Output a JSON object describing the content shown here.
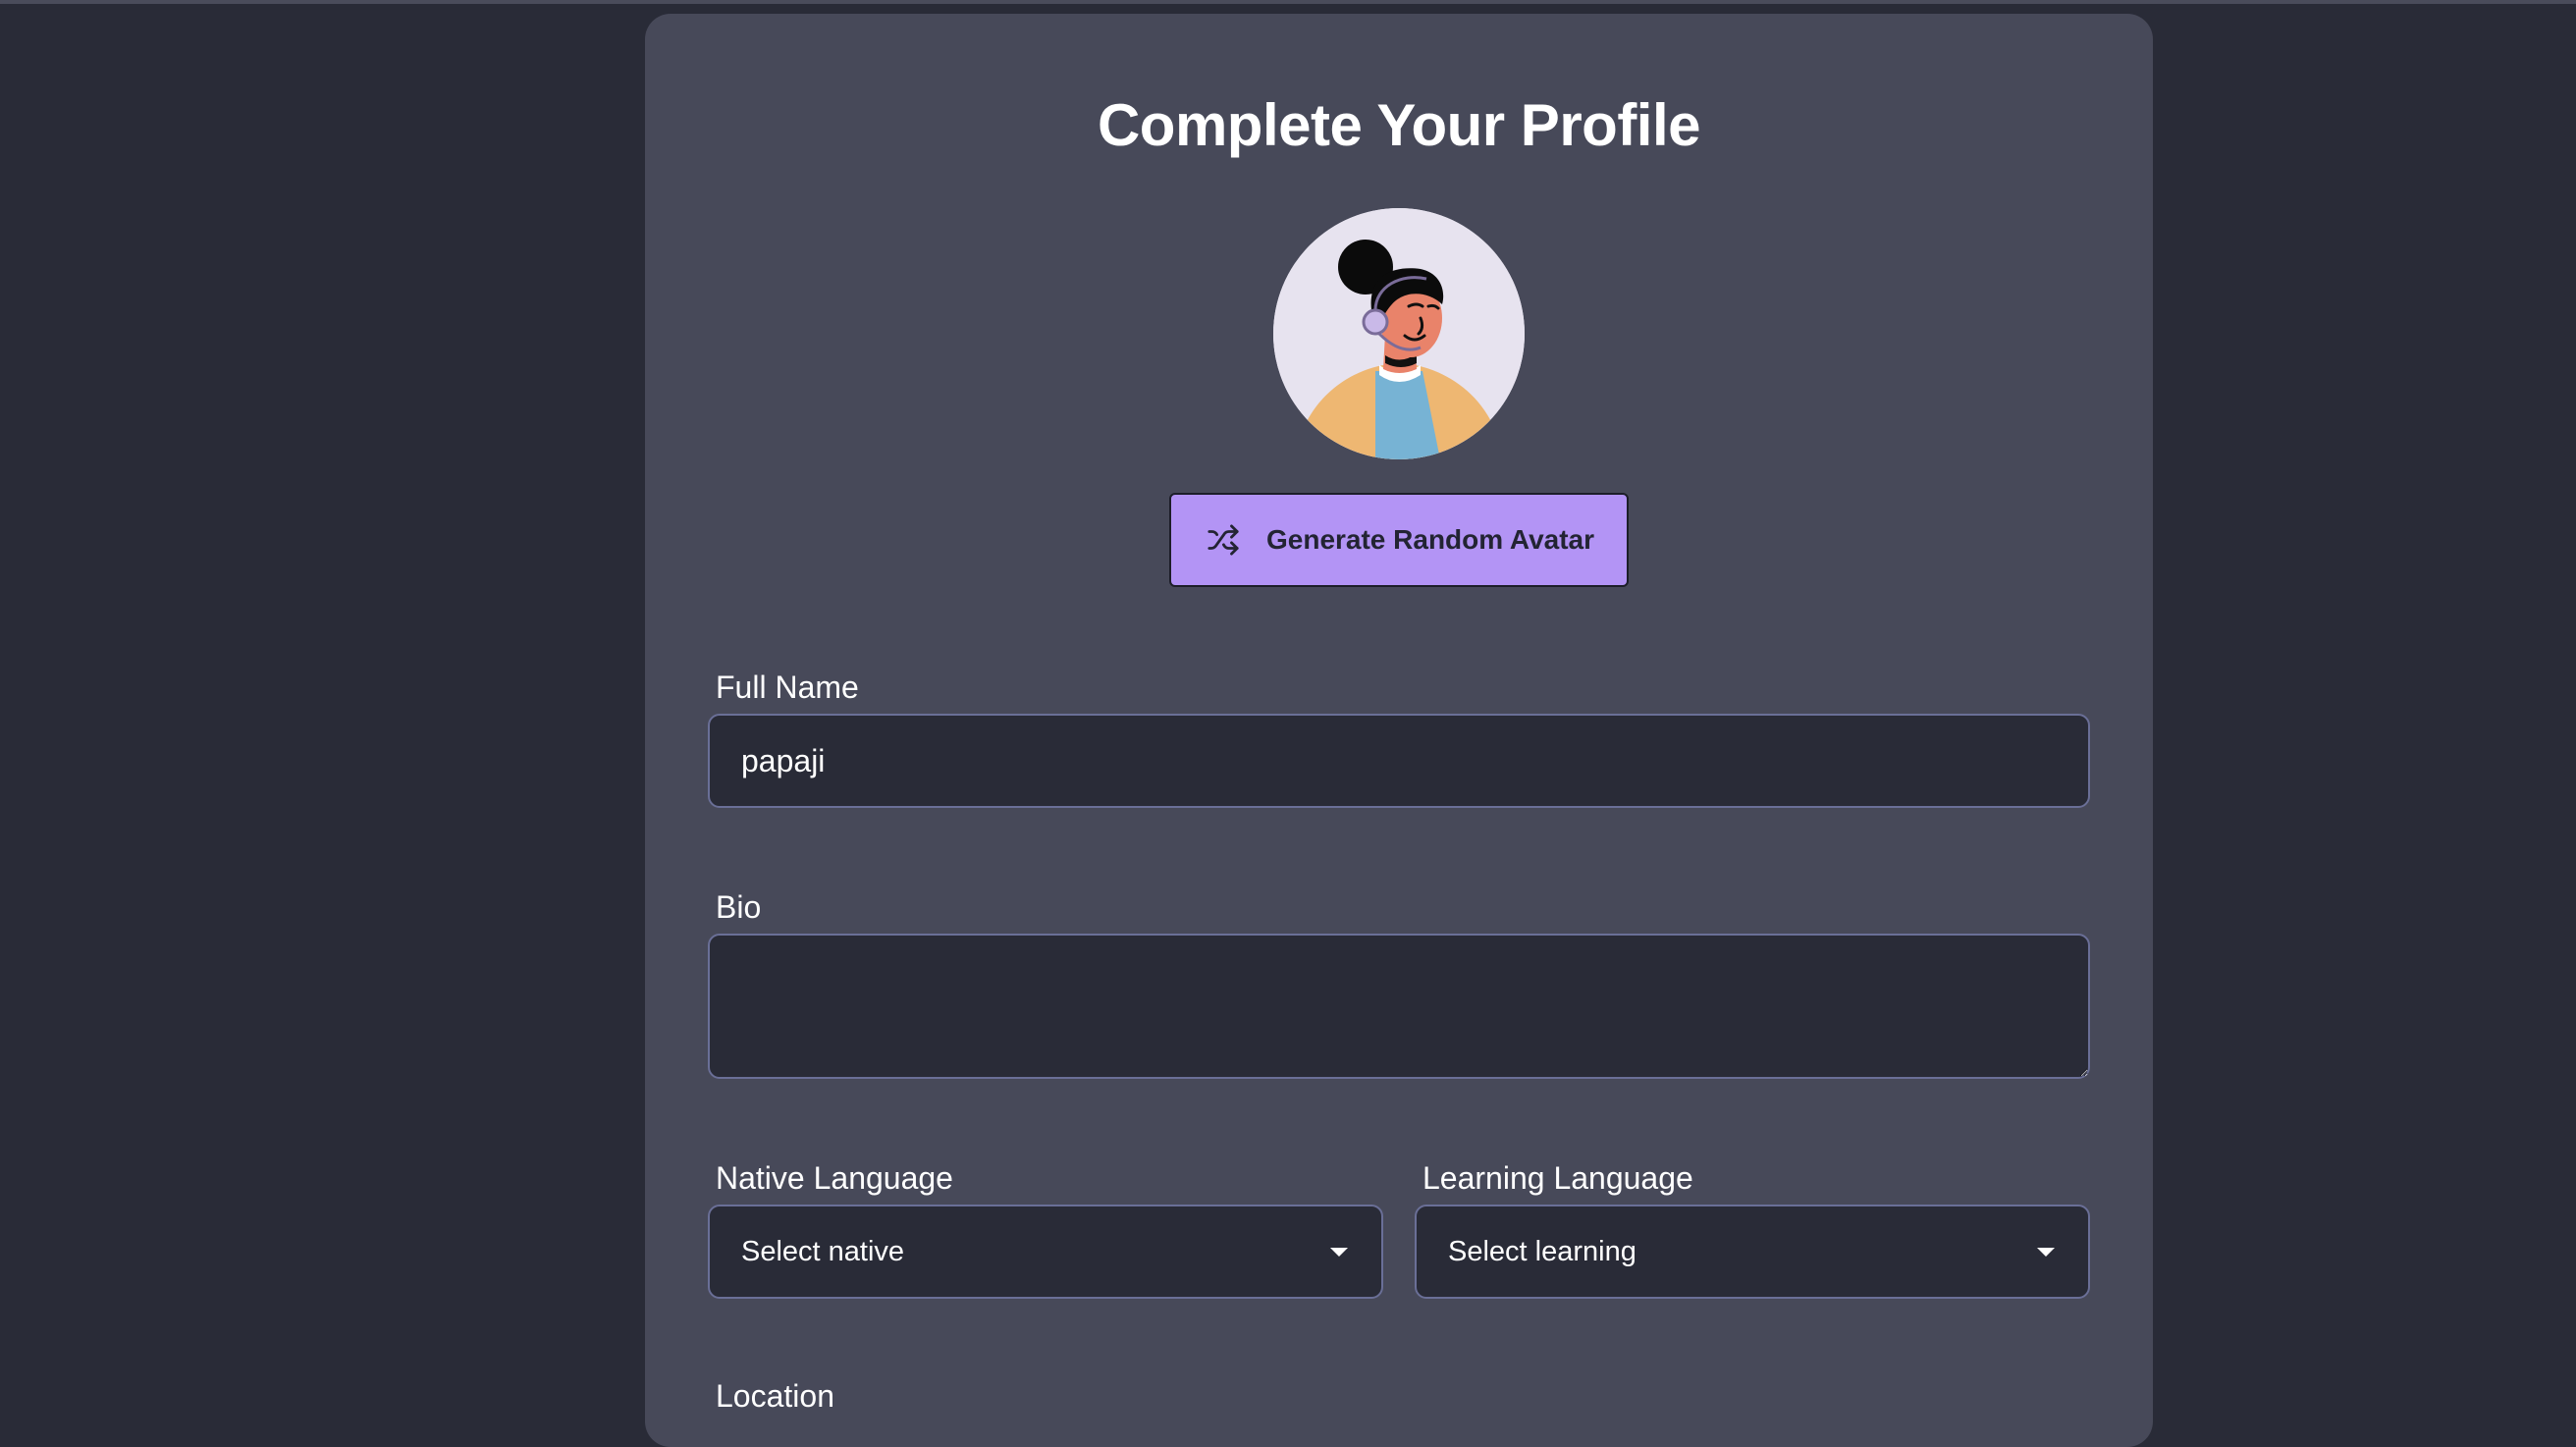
{
  "page": {
    "title": "Complete Your Profile"
  },
  "avatar": {
    "alt": "avatar"
  },
  "generate_button": {
    "label": "Generate Random Avatar",
    "icon": "shuffle-icon"
  },
  "fields": {
    "full_name": {
      "label": "Full Name",
      "value": "papaji"
    },
    "bio": {
      "label": "Bio",
      "value": ""
    },
    "native_language": {
      "label": "Native Language",
      "selected": "Select native"
    },
    "learning_language": {
      "label": "Learning Language",
      "selected": "Select learning"
    },
    "location": {
      "label": "Location"
    }
  },
  "colors": {
    "page_bg": "#292b37",
    "card_bg": "#474959",
    "accent": "#b394f5",
    "input_border": "#6a6f97"
  }
}
